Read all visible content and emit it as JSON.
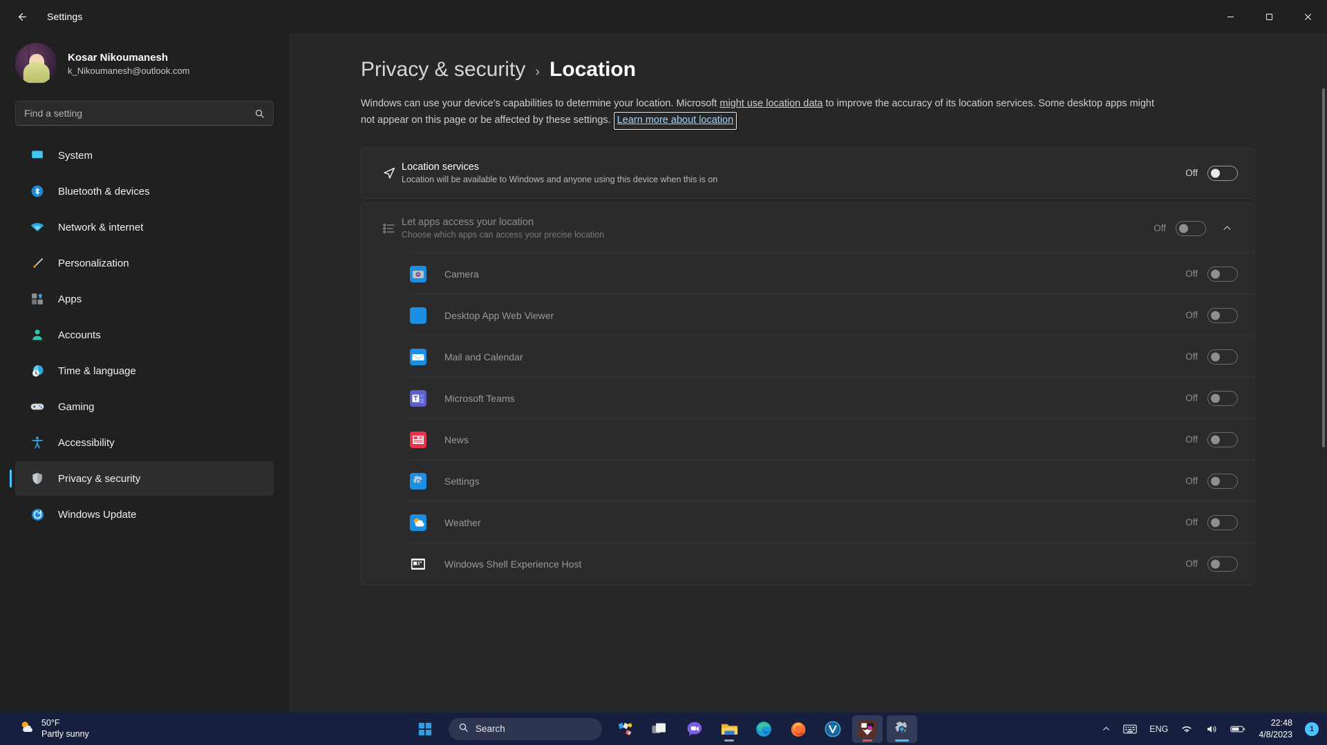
{
  "window": {
    "title": "Settings",
    "back_icon": "arrow-left-icon",
    "minimize_label": "−",
    "maximize_label": "☐",
    "close_label": "✕"
  },
  "account": {
    "name": "Kosar Nikoumanesh",
    "email": "k_Nikoumanesh@outlook.com"
  },
  "search": {
    "placeholder": "Find a setting",
    "value": "",
    "icon": "search-icon"
  },
  "sidebar": {
    "items": [
      {
        "label": "System",
        "icon": "system-icon",
        "selected": false
      },
      {
        "label": "Bluetooth & devices",
        "icon": "bluetooth-icon",
        "selected": false
      },
      {
        "label": "Network & internet",
        "icon": "wifi-icon",
        "selected": false
      },
      {
        "label": "Personalization",
        "icon": "paintbrush-icon",
        "selected": false
      },
      {
        "label": "Apps",
        "icon": "apps-icon",
        "selected": false
      },
      {
        "label": "Accounts",
        "icon": "account-icon",
        "selected": false
      },
      {
        "label": "Time & language",
        "icon": "clock-globe-icon",
        "selected": false
      },
      {
        "label": "Gaming",
        "icon": "gamepad-icon",
        "selected": false
      },
      {
        "label": "Accessibility",
        "icon": "accessibility-icon",
        "selected": false
      },
      {
        "label": "Privacy & security",
        "icon": "shield-icon",
        "selected": true
      },
      {
        "label": "Windows Update",
        "icon": "update-icon",
        "selected": false
      }
    ]
  },
  "breadcrumb": {
    "parent": "Privacy & security",
    "separator": "›",
    "current": "Location"
  },
  "description": {
    "part1": "Windows can use your device's capabilities to determine your location. Microsoft ",
    "underlined": "might use location data",
    "part2": " to improve the accuracy of its location services. Some desktop apps might not appear on this page or be affected by these settings. ",
    "link": "Learn more about location"
  },
  "location_services": {
    "title": "Location services",
    "subtitle": "Location will be available to Windows and anyone using this device when this is on",
    "icon": "location-arrow-icon",
    "toggle_label": "Off",
    "toggle_state": "off"
  },
  "let_apps": {
    "title": "Let apps access your location",
    "subtitle": "Choose which apps can access your precise location",
    "icon": "app-list-icon",
    "toggle_label": "Off",
    "toggle_state": "off",
    "expanded": true,
    "chevron_icon": "chevron-up-icon"
  },
  "apps": [
    {
      "name": "Camera",
      "icon": "camera-app-icon",
      "toggle_label": "Off",
      "toggle_state": "off"
    },
    {
      "name": "Desktop App Web Viewer",
      "icon": "desktop-web-viewer-icon",
      "toggle_label": "Off",
      "toggle_state": "off"
    },
    {
      "name": "Mail and Calendar",
      "icon": "mail-app-icon",
      "toggle_label": "Off",
      "toggle_state": "off"
    },
    {
      "name": "Microsoft Teams",
      "icon": "teams-app-icon",
      "toggle_label": "Off",
      "toggle_state": "off"
    },
    {
      "name": "News",
      "icon": "news-app-icon",
      "toggle_label": "Off",
      "toggle_state": "off"
    },
    {
      "name": "Settings",
      "icon": "settings-app-icon",
      "toggle_label": "Off",
      "toggle_state": "off"
    },
    {
      "name": "Weather",
      "icon": "weather-app-icon",
      "toggle_label": "Off",
      "toggle_state": "off"
    },
    {
      "name": "Windows Shell Experience Host",
      "icon": "shell-host-icon",
      "toggle_label": "Off",
      "toggle_state": "off"
    }
  ],
  "taskbar": {
    "weather": {
      "temperature": "50°F",
      "condition": "Partly sunny",
      "icon": "partly-sunny-icon"
    },
    "start_label": "Start",
    "search_label": "Search",
    "search_icon": "search-icon",
    "items": [
      {
        "name": "widgets-icon"
      },
      {
        "name": "task-view-icon"
      },
      {
        "name": "chat-icon"
      },
      {
        "name": "file-explorer-icon"
      },
      {
        "name": "edge-icon"
      },
      {
        "name": "firefox-icon"
      },
      {
        "name": "v-app-icon"
      },
      {
        "name": "minecraft-icon"
      },
      {
        "name": "settings-taskbar-icon"
      }
    ],
    "tray": {
      "chevron_label": "∧",
      "keyboard_icon": "keyboard-icon",
      "language": "ENG",
      "wifi_icon": "wifi-tray-icon",
      "volume_icon": "volume-icon",
      "battery_icon": "battery-icon",
      "time": "22:48",
      "date": "4/8/2023",
      "notification_count": "1"
    }
  },
  "colors": {
    "accent": "#4cc2ff",
    "window_bg": "#202020",
    "content_bg": "#272727",
    "card_bg": "#2b2b2b"
  }
}
